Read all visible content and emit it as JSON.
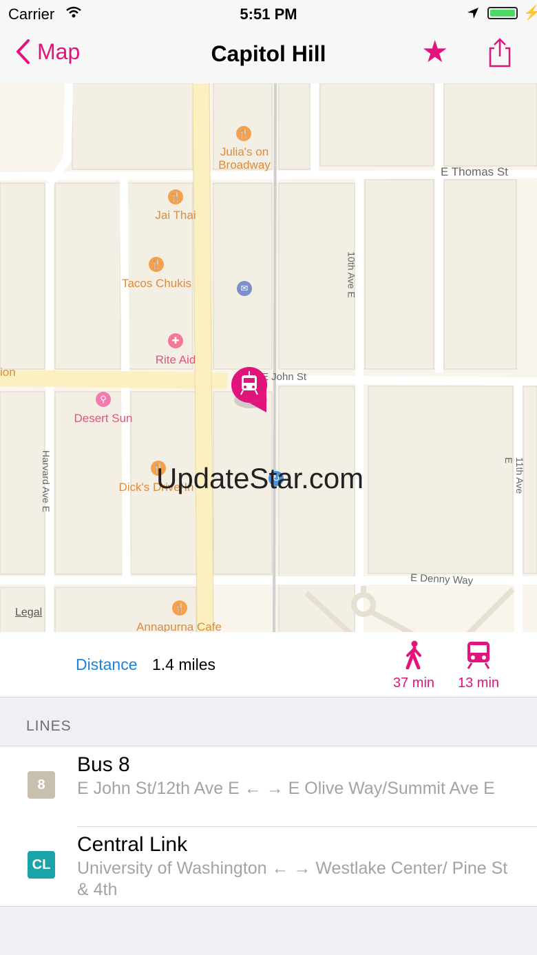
{
  "status": {
    "carrier": "Carrier",
    "time": "5:51 PM"
  },
  "nav": {
    "back_label": "Map",
    "title": "Capitol Hill"
  },
  "map": {
    "streets": {
      "thomas": "E Thomas St",
      "john": "E John St",
      "tenth": "10th Ave E",
      "harvard": "Harvard Ave E",
      "eleventh": "11th Ave E",
      "denny": "E Denny Way",
      "olive_partial": "ion"
    },
    "pois": {
      "julias": "Julia's on Broadway",
      "jai_thai": "Jai Thai",
      "tacos": "Tacos Chukis",
      "rite_aid": "Rite Aid",
      "desert_sun": "Desert Sun",
      "dicks": "Dick's Drive-In",
      "annapurna": "Annapurna Cafe"
    },
    "legal": "Legal",
    "watermark": "UpdateStar.com"
  },
  "info": {
    "distance_label": "Distance",
    "distance_value": "1.4 miles",
    "walk_time": "37 min",
    "transit_time": "13 min"
  },
  "lines_header": "LINES",
  "lines": [
    {
      "badge": "8",
      "badge_color": "#c8bfae",
      "name": "Bus 8",
      "route": "E John St/12th Ave E ← → E Olive Way/Summit Ave E"
    },
    {
      "badge": "CL",
      "badge_color": "#1aa3a8",
      "name": "Central Link",
      "route": "University of Washington ← → Westlake Center/ Pine St & 4th"
    }
  ],
  "colors": {
    "accent": "#e0147a",
    "link": "#1a82e0"
  }
}
